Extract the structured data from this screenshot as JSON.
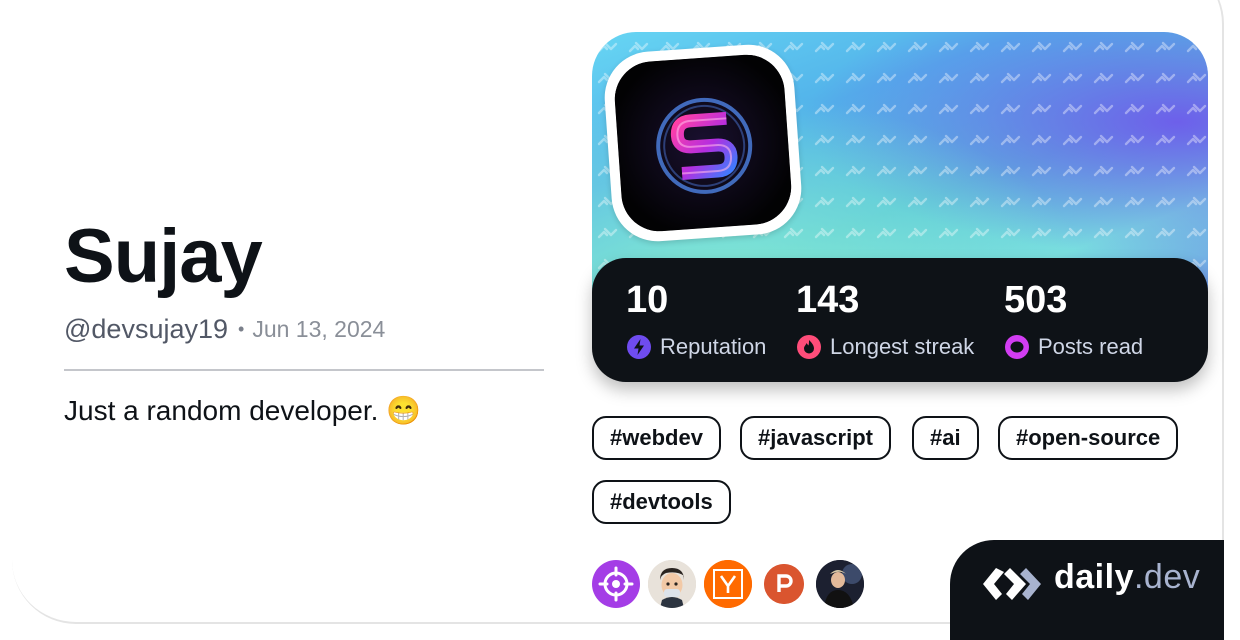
{
  "profile": {
    "name": "Sujay",
    "handle": "@devsujay19",
    "separator": "•",
    "joined": "Jun 13, 2024",
    "bio": "Just a random developer. 😁"
  },
  "stats": [
    {
      "value": "10",
      "label": "Reputation",
      "icon": "reputation-bolt-icon",
      "color": "#6f4cf0"
    },
    {
      "value": "143",
      "label": "Longest streak",
      "icon": "streak-flame-icon",
      "color": "#ff4d7a"
    },
    {
      "value": "503",
      "label": "Posts read",
      "icon": "posts-read-ring-icon",
      "color": "#d23df2"
    }
  ],
  "tags": [
    "#webdev",
    "#javascript",
    "#ai",
    "#open-source",
    "#devtools"
  ],
  "sources": [
    {
      "name": "crosshair-source",
      "color": "#a43de6"
    },
    {
      "name": "memoji-source",
      "color": "#d6cfc5"
    },
    {
      "name": "hacker-news-source",
      "color": "#ff6a00",
      "letter": "Y"
    },
    {
      "name": "product-hunt-source",
      "color": "#da552f",
      "letter": "P"
    },
    {
      "name": "person-source",
      "color": "#2b2f3a"
    }
  ],
  "brand": {
    "name": "daily",
    "tld": ".dev"
  },
  "colors": {
    "ink": "#0e1217",
    "accent_purple": "#6f4cf0",
    "accent_pink": "#ff4d7a"
  }
}
